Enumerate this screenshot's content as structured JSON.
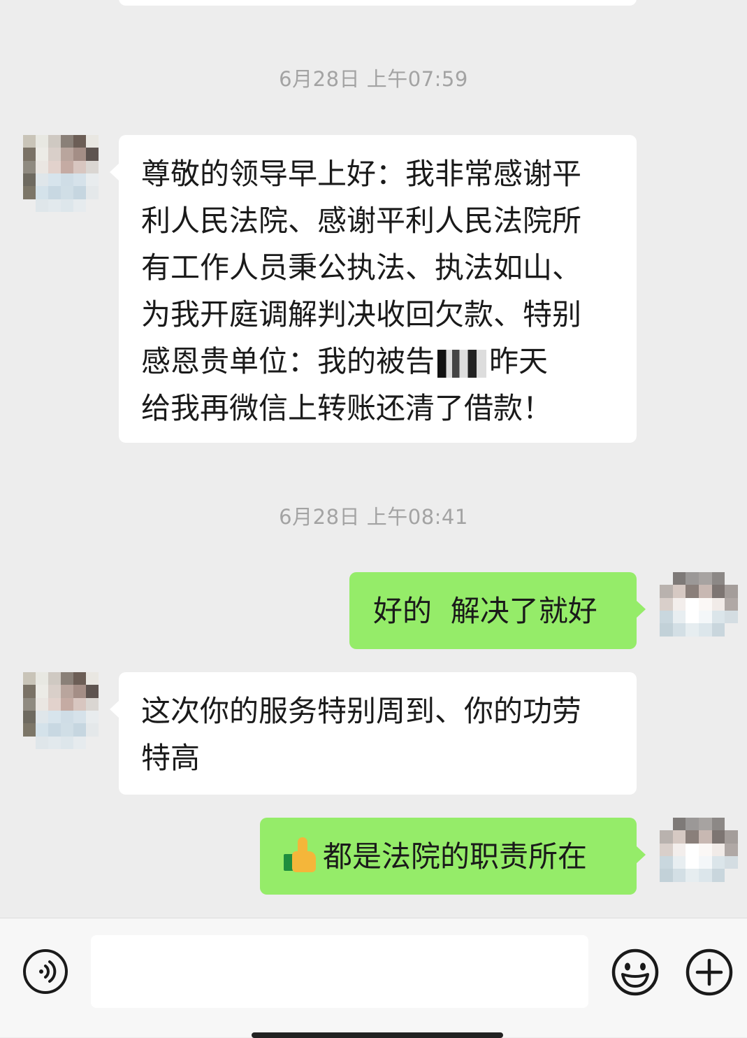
{
  "messages": [
    {
      "type": "timestamp",
      "text": "6月28日 上午07:59"
    },
    {
      "type": "incoming",
      "lines": [
        "尊敬的领导早上好：我非常感谢平",
        "利人民法院、感谢平利人民法院所",
        "有工作人员秉公执法、执法如山、",
        "为我开庭调解判决收回欠款、特别"
      ],
      "line5_before": "感恩贵单位：我的被告",
      "line5_after": "昨天",
      "line6": "给我再微信上转账还清了借款！"
    },
    {
      "type": "timestamp",
      "text": "6月28日 上午08:41"
    },
    {
      "type": "outgoing",
      "text": "好的  解决了就好"
    },
    {
      "type": "incoming",
      "lines": [
        "这次你的服务特别周到、你的功劳",
        "特高"
      ]
    },
    {
      "type": "outgoing",
      "text": "都是法院的职责所在",
      "prefix_icon": "thumbs-up-icon"
    }
  ],
  "footer": {
    "input_value": "",
    "icons": [
      "voice-icon",
      "emoji-icon",
      "plus-icon"
    ]
  },
  "colors": {
    "background": "#ededed",
    "incoming_bubble": "#ffffff",
    "outgoing_bubble": "#95ec69",
    "timestamp": "#a3a3a3"
  }
}
